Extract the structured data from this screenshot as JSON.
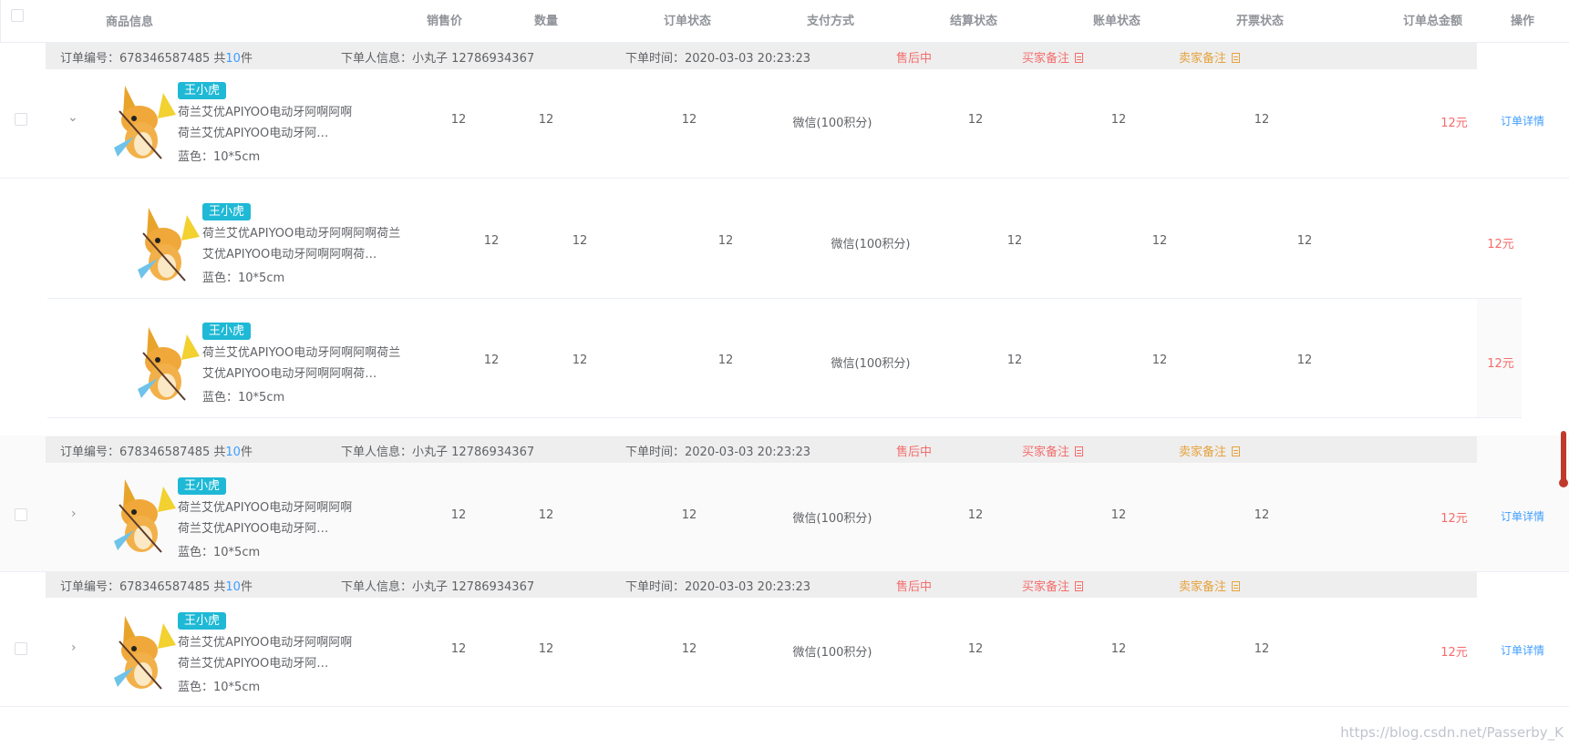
{
  "header": {
    "product_info": "商品信息",
    "sale_price": "销售价",
    "quantity": "数量",
    "order_status": "订单状态",
    "payment_method": "支付方式",
    "settlement_status": "结算状态",
    "bill_status": "账单状态",
    "invoice_status": "开票状态",
    "total_amount": "订单总金额",
    "action": "操作"
  },
  "order_strip": {
    "order_no_label": "订单编号：678346587485 共",
    "count": "10",
    "count_suffix": "件",
    "buyer": "下单人信息：小丸子 12786934367",
    "time": "下单时间：2020-03-03 20:23:23",
    "status": "售后中",
    "buyer_note": "买家备注",
    "seller_note": "卖家备注"
  },
  "product": {
    "tag": "王小虎",
    "name_short": "荷兰艾优APIYOO电动牙阿啊阿啊荷兰艾优APIYOO电动牙阿…",
    "name_long": "荷兰艾优APIYOO电动牙阿啊阿啊荷兰艾优APIYOO电动牙阿啊阿啊荷…",
    "spec": "蓝色：10*5cm"
  },
  "cells": {
    "price": "12",
    "qty": "12",
    "order_status": "12",
    "payment": "微信(100积分)",
    "settlement": "12",
    "bill": "12",
    "invoice": "12",
    "total": "12元",
    "detail_link": "订单详情"
  },
  "icons": {
    "expand_open": "chevron-down-icon",
    "expand_closed": "chevron-right-icon",
    "note": "note-icon"
  },
  "colors": {
    "tag_bg": "#1fb9d6",
    "link": "#409eff",
    "danger": "#f56c6c",
    "warning": "#e6a23c"
  },
  "watermark": "https://blog.csdn.net/Passerby_K"
}
